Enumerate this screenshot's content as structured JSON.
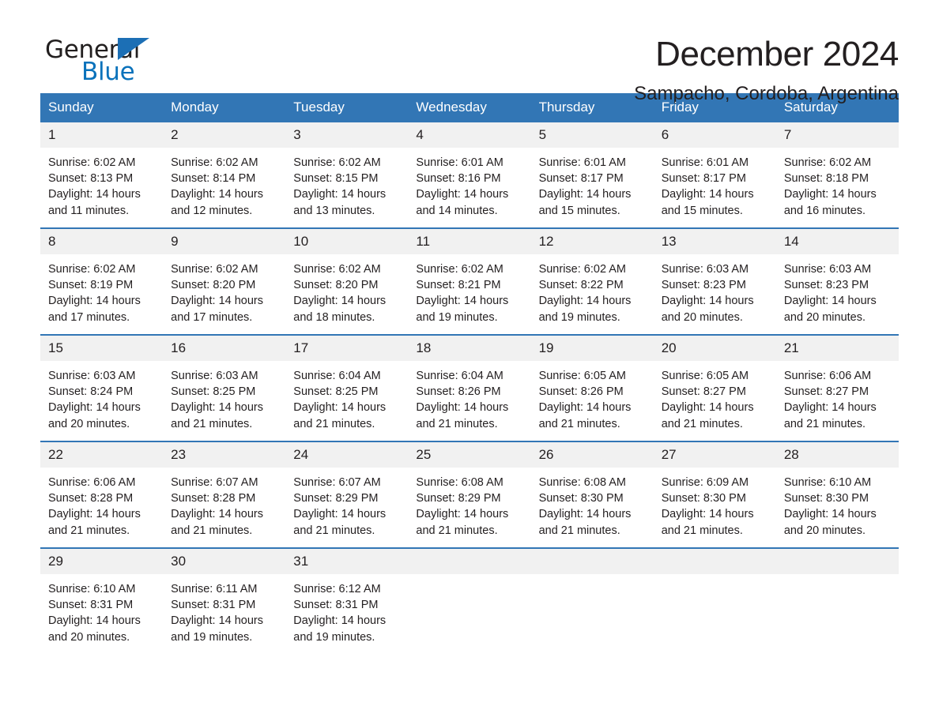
{
  "brand": {
    "name_part1": "General",
    "name_part2": "Blue",
    "triangle_icon": "triangle-logo-mark",
    "color_dark": "#221f1f",
    "color_blue": "#0a72bb"
  },
  "header": {
    "title": "December 2024",
    "location": "Sampacho, Cordoba, Argentina"
  },
  "theme": {
    "header_blue": "#3276b5",
    "daynum_gray": "#f1f1f1",
    "text": "#231f20"
  },
  "weekday_headers": [
    "Sunday",
    "Monday",
    "Tuesday",
    "Wednesday",
    "Thursday",
    "Friday",
    "Saturday"
  ],
  "weeks": [
    [
      {
        "day": "1",
        "sunrise": "Sunrise: 6:02 AM",
        "sunset": "Sunset: 8:13 PM",
        "daylight_line1": "Daylight: 14 hours",
        "daylight_line2": "and 11 minutes."
      },
      {
        "day": "2",
        "sunrise": "Sunrise: 6:02 AM",
        "sunset": "Sunset: 8:14 PM",
        "daylight_line1": "Daylight: 14 hours",
        "daylight_line2": "and 12 minutes."
      },
      {
        "day": "3",
        "sunrise": "Sunrise: 6:02 AM",
        "sunset": "Sunset: 8:15 PM",
        "daylight_line1": "Daylight: 14 hours",
        "daylight_line2": "and 13 minutes."
      },
      {
        "day": "4",
        "sunrise": "Sunrise: 6:01 AM",
        "sunset": "Sunset: 8:16 PM",
        "daylight_line1": "Daylight: 14 hours",
        "daylight_line2": "and 14 minutes."
      },
      {
        "day": "5",
        "sunrise": "Sunrise: 6:01 AM",
        "sunset": "Sunset: 8:17 PM",
        "daylight_line1": "Daylight: 14 hours",
        "daylight_line2": "and 15 minutes."
      },
      {
        "day": "6",
        "sunrise": "Sunrise: 6:01 AM",
        "sunset": "Sunset: 8:17 PM",
        "daylight_line1": "Daylight: 14 hours",
        "daylight_line2": "and 15 minutes."
      },
      {
        "day": "7",
        "sunrise": "Sunrise: 6:02 AM",
        "sunset": "Sunset: 8:18 PM",
        "daylight_line1": "Daylight: 14 hours",
        "daylight_line2": "and 16 minutes."
      }
    ],
    [
      {
        "day": "8",
        "sunrise": "Sunrise: 6:02 AM",
        "sunset": "Sunset: 8:19 PM",
        "daylight_line1": "Daylight: 14 hours",
        "daylight_line2": "and 17 minutes."
      },
      {
        "day": "9",
        "sunrise": "Sunrise: 6:02 AM",
        "sunset": "Sunset: 8:20 PM",
        "daylight_line1": "Daylight: 14 hours",
        "daylight_line2": "and 17 minutes."
      },
      {
        "day": "10",
        "sunrise": "Sunrise: 6:02 AM",
        "sunset": "Sunset: 8:20 PM",
        "daylight_line1": "Daylight: 14 hours",
        "daylight_line2": "and 18 minutes."
      },
      {
        "day": "11",
        "sunrise": "Sunrise: 6:02 AM",
        "sunset": "Sunset: 8:21 PM",
        "daylight_line1": "Daylight: 14 hours",
        "daylight_line2": "and 19 minutes."
      },
      {
        "day": "12",
        "sunrise": "Sunrise: 6:02 AM",
        "sunset": "Sunset: 8:22 PM",
        "daylight_line1": "Daylight: 14 hours",
        "daylight_line2": "and 19 minutes."
      },
      {
        "day": "13",
        "sunrise": "Sunrise: 6:03 AM",
        "sunset": "Sunset: 8:23 PM",
        "daylight_line1": "Daylight: 14 hours",
        "daylight_line2": "and 20 minutes."
      },
      {
        "day": "14",
        "sunrise": "Sunrise: 6:03 AM",
        "sunset": "Sunset: 8:23 PM",
        "daylight_line1": "Daylight: 14 hours",
        "daylight_line2": "and 20 minutes."
      }
    ],
    [
      {
        "day": "15",
        "sunrise": "Sunrise: 6:03 AM",
        "sunset": "Sunset: 8:24 PM",
        "daylight_line1": "Daylight: 14 hours",
        "daylight_line2": "and 20 minutes."
      },
      {
        "day": "16",
        "sunrise": "Sunrise: 6:03 AM",
        "sunset": "Sunset: 8:25 PM",
        "daylight_line1": "Daylight: 14 hours",
        "daylight_line2": "and 21 minutes."
      },
      {
        "day": "17",
        "sunrise": "Sunrise: 6:04 AM",
        "sunset": "Sunset: 8:25 PM",
        "daylight_line1": "Daylight: 14 hours",
        "daylight_line2": "and 21 minutes."
      },
      {
        "day": "18",
        "sunrise": "Sunrise: 6:04 AM",
        "sunset": "Sunset: 8:26 PM",
        "daylight_line1": "Daylight: 14 hours",
        "daylight_line2": "and 21 minutes."
      },
      {
        "day": "19",
        "sunrise": "Sunrise: 6:05 AM",
        "sunset": "Sunset: 8:26 PM",
        "daylight_line1": "Daylight: 14 hours",
        "daylight_line2": "and 21 minutes."
      },
      {
        "day": "20",
        "sunrise": "Sunrise: 6:05 AM",
        "sunset": "Sunset: 8:27 PM",
        "daylight_line1": "Daylight: 14 hours",
        "daylight_line2": "and 21 minutes."
      },
      {
        "day": "21",
        "sunrise": "Sunrise: 6:06 AM",
        "sunset": "Sunset: 8:27 PM",
        "daylight_line1": "Daylight: 14 hours",
        "daylight_line2": "and 21 minutes."
      }
    ],
    [
      {
        "day": "22",
        "sunrise": "Sunrise: 6:06 AM",
        "sunset": "Sunset: 8:28 PM",
        "daylight_line1": "Daylight: 14 hours",
        "daylight_line2": "and 21 minutes."
      },
      {
        "day": "23",
        "sunrise": "Sunrise: 6:07 AM",
        "sunset": "Sunset: 8:28 PM",
        "daylight_line1": "Daylight: 14 hours",
        "daylight_line2": "and 21 minutes."
      },
      {
        "day": "24",
        "sunrise": "Sunrise: 6:07 AM",
        "sunset": "Sunset: 8:29 PM",
        "daylight_line1": "Daylight: 14 hours",
        "daylight_line2": "and 21 minutes."
      },
      {
        "day": "25",
        "sunrise": "Sunrise: 6:08 AM",
        "sunset": "Sunset: 8:29 PM",
        "daylight_line1": "Daylight: 14 hours",
        "daylight_line2": "and 21 minutes."
      },
      {
        "day": "26",
        "sunrise": "Sunrise: 6:08 AM",
        "sunset": "Sunset: 8:30 PM",
        "daylight_line1": "Daylight: 14 hours",
        "daylight_line2": "and 21 minutes."
      },
      {
        "day": "27",
        "sunrise": "Sunrise: 6:09 AM",
        "sunset": "Sunset: 8:30 PM",
        "daylight_line1": "Daylight: 14 hours",
        "daylight_line2": "and 21 minutes."
      },
      {
        "day": "28",
        "sunrise": "Sunrise: 6:10 AM",
        "sunset": "Sunset: 8:30 PM",
        "daylight_line1": "Daylight: 14 hours",
        "daylight_line2": "and 20 minutes."
      }
    ],
    [
      {
        "day": "29",
        "sunrise": "Sunrise: 6:10 AM",
        "sunset": "Sunset: 8:31 PM",
        "daylight_line1": "Daylight: 14 hours",
        "daylight_line2": "and 20 minutes."
      },
      {
        "day": "30",
        "sunrise": "Sunrise: 6:11 AM",
        "sunset": "Sunset: 8:31 PM",
        "daylight_line1": "Daylight: 14 hours",
        "daylight_line2": "and 19 minutes."
      },
      {
        "day": "31",
        "sunrise": "Sunrise: 6:12 AM",
        "sunset": "Sunset: 8:31 PM",
        "daylight_line1": "Daylight: 14 hours",
        "daylight_line2": "and 19 minutes."
      },
      {
        "day": "",
        "sunrise": "",
        "sunset": "",
        "daylight_line1": "",
        "daylight_line2": ""
      },
      {
        "day": "",
        "sunrise": "",
        "sunset": "",
        "daylight_line1": "",
        "daylight_line2": ""
      },
      {
        "day": "",
        "sunrise": "",
        "sunset": "",
        "daylight_line1": "",
        "daylight_line2": ""
      },
      {
        "day": "",
        "sunrise": "",
        "sunset": "",
        "daylight_line1": "",
        "daylight_line2": ""
      }
    ]
  ]
}
